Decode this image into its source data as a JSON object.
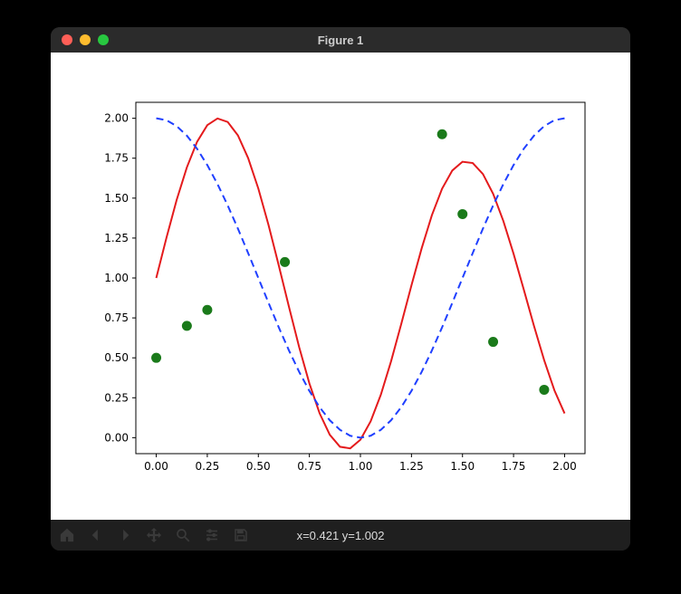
{
  "window": {
    "title": "Figure 1"
  },
  "toolbar": {
    "coord_readout": "x=0.421 y=1.002"
  },
  "chart_data": {
    "type": "multi",
    "xlim": [
      -0.1,
      2.1
    ],
    "ylim": [
      -0.1,
      2.1
    ],
    "xticks": [
      "0.00",
      "0.25",
      "0.50",
      "0.75",
      "1.00",
      "1.25",
      "1.50",
      "1.75",
      "2.00"
    ],
    "yticks": [
      "0.00",
      "0.25",
      "0.50",
      "0.75",
      "1.00",
      "1.25",
      "1.50",
      "1.75",
      "2.00"
    ],
    "series": [
      {
        "name": "red-solid",
        "type": "line",
        "style": "solid",
        "color": "#e41a1c",
        "formula": "1 + sin(5.1x)",
        "x": [
          0.0,
          0.05,
          0.1,
          0.15,
          0.2,
          0.25,
          0.3,
          0.35,
          0.4,
          0.45,
          0.5,
          0.55,
          0.6,
          0.65,
          0.7,
          0.75,
          0.8,
          0.85,
          0.9,
          0.95,
          1.0,
          1.05,
          1.1,
          1.15,
          1.2,
          1.25,
          1.3,
          1.35,
          1.4,
          1.45,
          1.5,
          1.55,
          1.6,
          1.65,
          1.7,
          1.75,
          1.8,
          1.85,
          1.9,
          1.95,
          2.0
        ],
        "y": [
          1.0,
          1.252,
          1.489,
          1.693,
          1.853,
          1.957,
          1.999,
          1.977,
          1.893,
          1.751,
          1.56,
          1.331,
          1.079,
          0.819,
          0.567,
          0.34,
          0.153,
          0.018,
          -0.057,
          -0.067,
          -0.013,
          0.102,
          0.269,
          0.478,
          0.712,
          0.954,
          1.186,
          1.393,
          1.559,
          1.673,
          1.728,
          1.72,
          1.651,
          1.527,
          1.357,
          1.152,
          0.928,
          0.7,
          0.485,
          0.297,
          0.152
        ]
      },
      {
        "name": "blue-dashed",
        "type": "line",
        "style": "dashed",
        "color": "#1f3fff",
        "formula": "1 + cos(pi x)",
        "x": [
          0.0,
          0.05,
          0.1,
          0.15,
          0.2,
          0.25,
          0.3,
          0.35,
          0.4,
          0.45,
          0.5,
          0.55,
          0.6,
          0.65,
          0.7,
          0.75,
          0.8,
          0.85,
          0.9,
          0.95,
          1.0,
          1.05,
          1.1,
          1.15,
          1.2,
          1.25,
          1.3,
          1.35,
          1.4,
          1.45,
          1.5,
          1.55,
          1.6,
          1.65,
          1.7,
          1.75,
          1.8,
          1.85,
          1.9,
          1.95,
          2.0
        ],
        "y": [
          2.0,
          1.988,
          1.951,
          1.891,
          1.809,
          1.707,
          1.588,
          1.454,
          1.309,
          1.156,
          1.0,
          0.844,
          0.691,
          0.546,
          0.412,
          0.293,
          0.191,
          0.109,
          0.049,
          0.012,
          0.0,
          0.012,
          0.049,
          0.109,
          0.191,
          0.293,
          0.412,
          0.546,
          0.691,
          0.844,
          1.0,
          1.156,
          1.309,
          1.454,
          1.588,
          1.707,
          1.809,
          1.891,
          1.951,
          1.988,
          2.0
        ]
      },
      {
        "name": "green-scatter",
        "type": "scatter",
        "color": "#1a7a1a",
        "x": [
          0.0,
          0.15,
          0.25,
          0.63,
          1.4,
          1.5,
          1.65,
          1.9
        ],
        "y": [
          0.5,
          0.7,
          0.8,
          1.1,
          1.9,
          1.4,
          0.6,
          0.3
        ]
      }
    ]
  }
}
